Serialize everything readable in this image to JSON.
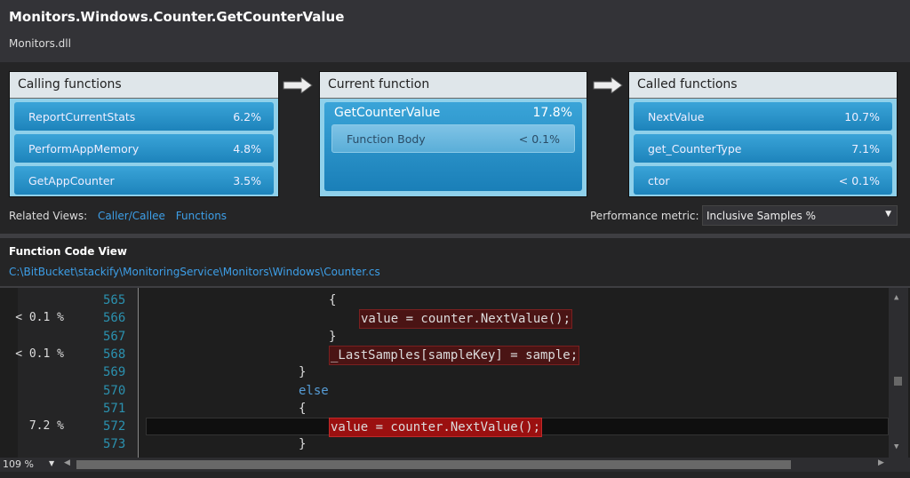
{
  "header": {
    "title": "Monitors.Windows.Counter.GetCounterValue",
    "module": "Monitors.dll"
  },
  "calling": {
    "title": "Calling functions",
    "items": [
      {
        "name": "ReportCurrentStats",
        "pct": "6.2%"
      },
      {
        "name": "PerformAppMemory",
        "pct": "4.8%"
      },
      {
        "name": "GetAppCounter",
        "pct": "3.5%"
      }
    ]
  },
  "current": {
    "title": "Current function",
    "name": "GetCounterValue",
    "pct": "17.8%",
    "body": {
      "name": "Function Body",
      "pct": "< 0.1%"
    }
  },
  "called": {
    "title": "Called functions",
    "items": [
      {
        "name": "NextValue",
        "pct": "10.7%"
      },
      {
        "name": "get_CounterType",
        "pct": "7.1%"
      },
      {
        "name": "ctor",
        "pct": "< 0.1%"
      }
    ]
  },
  "related": {
    "label": "Related Views:",
    "links": [
      "Caller/Callee",
      "Functions"
    ]
  },
  "metric": {
    "label": "Performance metric:",
    "value": "Inclusive Samples %"
  },
  "codeview": {
    "title": "Function Code View",
    "path": "C:\\BitBucket\\stackify\\MonitoringService\\Monitors\\Windows\\Counter.cs",
    "lines": [
      {
        "num": "565",
        "pct": "",
        "code": "{",
        "indent": 210,
        "hl": ""
      },
      {
        "num": "566",
        "pct": "< 0.1 %",
        "code": "value = counter.NextValue();",
        "indent": 244,
        "hl": "hl1"
      },
      {
        "num": "567",
        "pct": "",
        "code": "}",
        "indent": 210,
        "hl": ""
      },
      {
        "num": "568",
        "pct": "< 0.1 %",
        "code": "_LastSamples[sampleKey] = sample;",
        "indent": 210,
        "hl": "hl1"
      },
      {
        "num": "569",
        "pct": "",
        "code": "}",
        "indent": 176,
        "hl": ""
      },
      {
        "num": "570",
        "pct": "",
        "code": "else",
        "indent": 176,
        "hl": "",
        "kw": true
      },
      {
        "num": "571",
        "pct": "",
        "code": "{",
        "indent": 176,
        "hl": ""
      },
      {
        "num": "572",
        "pct": "7.2 %",
        "code": "value = counter.NextValue();",
        "indent": 210,
        "hl": "hl2",
        "current": true
      },
      {
        "num": "573",
        "pct": "",
        "code": "}",
        "indent": 176,
        "hl": ""
      }
    ]
  },
  "zoom": "109 %"
}
